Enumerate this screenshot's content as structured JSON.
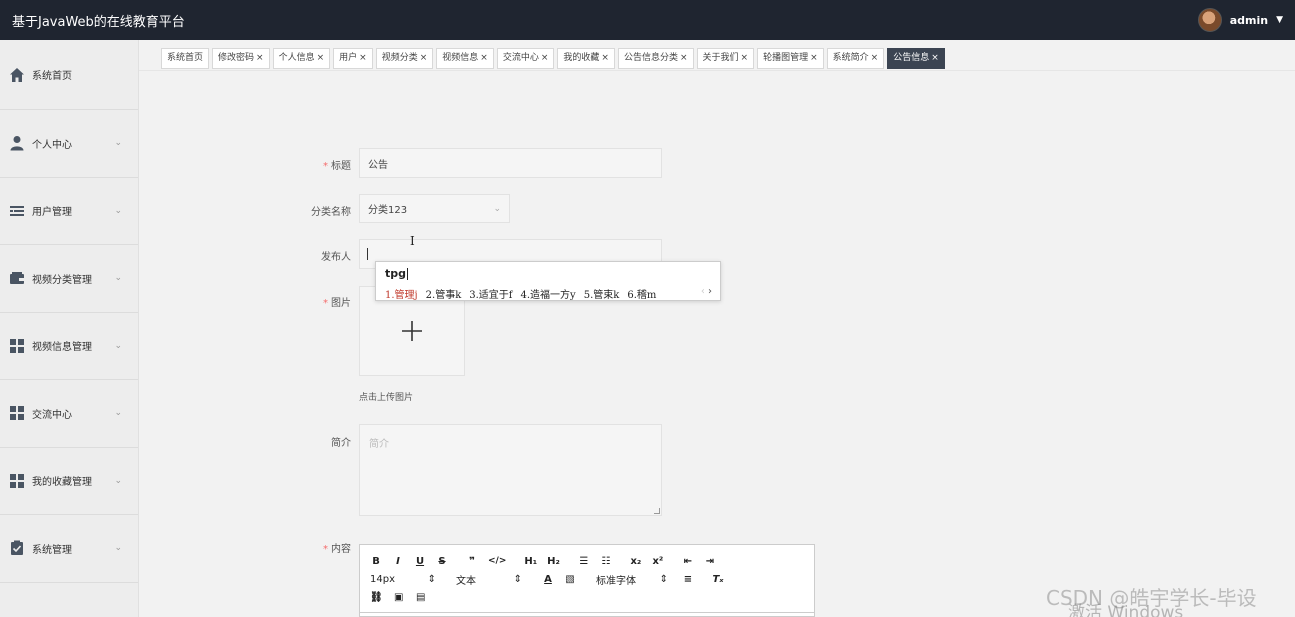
{
  "header": {
    "title": "基于JavaWeb的在线教育平台",
    "username": "admin"
  },
  "sidebar": {
    "items": [
      {
        "label": "系统首页",
        "icon": "home-icon"
      },
      {
        "label": "个人中心",
        "icon": "person-icon"
      },
      {
        "label": "用户管理",
        "icon": "list-icon"
      },
      {
        "label": "视频分类管理",
        "icon": "wallet-icon"
      },
      {
        "label": "视频信息管理",
        "icon": "grid-icon"
      },
      {
        "label": "交流中心",
        "icon": "grid-icon"
      },
      {
        "label": "我的收藏管理",
        "icon": "grid-icon"
      },
      {
        "label": "系统管理",
        "icon": "clipboard-check-icon"
      }
    ]
  },
  "tabs": [
    {
      "label": "系统首页",
      "closable": false
    },
    {
      "label": "修改密码",
      "closable": true
    },
    {
      "label": "个人信息",
      "closable": true
    },
    {
      "label": "用户",
      "closable": true
    },
    {
      "label": "视频分类",
      "closable": true
    },
    {
      "label": "视频信息",
      "closable": true
    },
    {
      "label": "交流中心",
      "closable": true
    },
    {
      "label": "我的收藏",
      "closable": true
    },
    {
      "label": "公告信息分类",
      "closable": true
    },
    {
      "label": "关于我们",
      "closable": true
    },
    {
      "label": "轮播图管理",
      "closable": true
    },
    {
      "label": "系统简介",
      "closable": true
    },
    {
      "label": "公告信息",
      "closable": true,
      "active": true
    }
  ],
  "form": {
    "title_label": "标题",
    "title_value": "公告",
    "category_label": "分类名称",
    "category_value": "分类123",
    "publisher_label": "发布人",
    "image_label": "图片",
    "upload_hint": "点击上传图片",
    "intro_label": "简介",
    "intro_placeholder": "简介",
    "content_label": "内容"
  },
  "editor": {
    "font_size": "14px",
    "text_type": "文本",
    "font_family": "标准字体"
  },
  "ime": {
    "composition": "tpg",
    "candidates": [
      "1.管理j",
      "2.管事k",
      "3.适宜于f",
      "4.造福一方y",
      "5.管束k",
      "6.稽m"
    ]
  },
  "overlay": {
    "watermark": "CSDN @皓宇学长-毕设",
    "activate": "激活 Windows"
  }
}
